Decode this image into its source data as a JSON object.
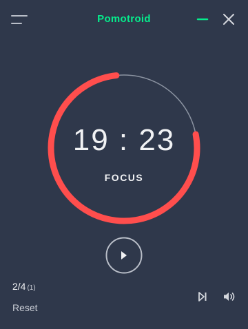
{
  "window": {
    "title": "Pomotroid",
    "title_color": "#05ec8c",
    "icons": {
      "menu": "hamburger-menu-icon",
      "minimize": "minimize-icon",
      "close": "close-icon"
    }
  },
  "timer": {
    "time": "19 : 23",
    "mode": "FOCUS",
    "progress_remaining_fraction": 0.78,
    "ring_color": "#ff4e4d",
    "track_color": "#8b93a1"
  },
  "controls": {
    "play_icon": "play-icon",
    "skip_icon": "skip-forward-icon",
    "volume_icon": "volume-icon"
  },
  "footer": {
    "round": "2/4",
    "total_rounds": "(1)",
    "reset_label": "Reset"
  },
  "colors": {
    "background": "#2f384b",
    "foreground": "#f1f2f4",
    "accent": "#05ec8c",
    "focus": "#ff4e4d"
  }
}
